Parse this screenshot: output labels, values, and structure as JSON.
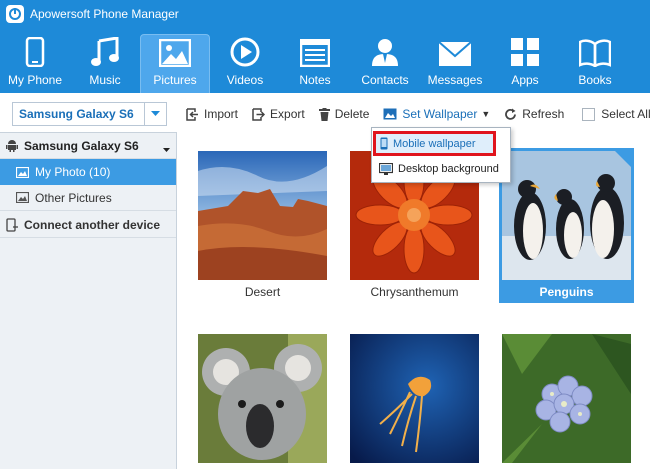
{
  "app": {
    "title": "Apowersoft Phone Manager"
  },
  "nav": [
    {
      "id": "myphone",
      "label": "My Phone",
      "icon": "phone-icon",
      "active": false
    },
    {
      "id": "music",
      "label": "Music",
      "icon": "music-note-icon",
      "active": false
    },
    {
      "id": "pictures",
      "label": "Pictures",
      "icon": "picture-icon",
      "active": true
    },
    {
      "id": "videos",
      "label": "Videos",
      "icon": "play-icon",
      "active": false
    },
    {
      "id": "notes",
      "label": "Notes",
      "icon": "notes-icon",
      "active": false
    },
    {
      "id": "contacts",
      "label": "Contacts",
      "icon": "contact-icon",
      "active": false
    },
    {
      "id": "messages",
      "label": "Messages",
      "icon": "envelope-icon",
      "active": false
    },
    {
      "id": "apps",
      "label": "Apps",
      "icon": "apps-grid-icon",
      "active": false
    },
    {
      "id": "books",
      "label": "Books",
      "icon": "book-icon",
      "active": false
    }
  ],
  "device_select": {
    "value": "Samsung Galaxy S6"
  },
  "sidebar": {
    "device": "Samsung Galaxy S6",
    "my_photo": "My Photo (10)",
    "other_pictures": "Other Pictures",
    "connect": "Connect another device"
  },
  "toolbar": {
    "import": "Import",
    "export": "Export",
    "delete": "Delete",
    "set_wallpaper": "Set Wallpaper",
    "refresh": "Refresh",
    "select_all": "Select All"
  },
  "wallpaper_menu": {
    "mobile": "Mobile wallpaper",
    "desktop": "Desktop background"
  },
  "photos": [
    {
      "caption": "Desert",
      "selected": false
    },
    {
      "caption": "Chrysanthemum",
      "selected": false
    },
    {
      "caption": "Penguins",
      "selected": true
    },
    {
      "caption": "",
      "selected": false
    },
    {
      "caption": "",
      "selected": false
    },
    {
      "caption": "",
      "selected": false
    }
  ],
  "colors": {
    "accent": "#1e8ad8",
    "selection": "#3c9be3",
    "highlight_border": "#e0141d"
  }
}
